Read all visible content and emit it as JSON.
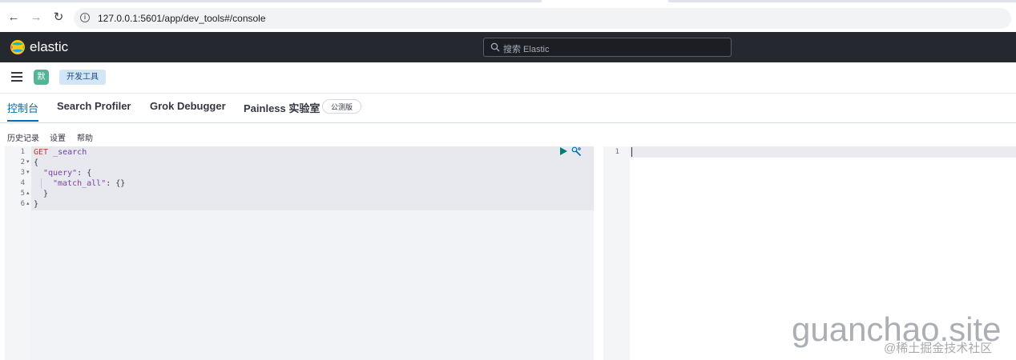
{
  "browser": {
    "back_icon": "arrow-left-icon",
    "forward_icon": "arrow-right-icon",
    "reload_icon": "reload-icon",
    "url": "127.0.0.1:5601/app/dev_tools#/console"
  },
  "header": {
    "logo_text": "elastic",
    "search_placeholder": "搜索 Elastic"
  },
  "breadcrumb": {
    "space_initial": "默",
    "current": "开发工具"
  },
  "tabs": [
    {
      "label": "控制台",
      "selected": true
    },
    {
      "label": "Search Profiler",
      "selected": false
    },
    {
      "label": "Grok Debugger",
      "selected": false
    },
    {
      "label": "Painless 实验室",
      "selected": false
    }
  ],
  "beta_badge": "公测版",
  "console_menu": [
    "历史记录",
    "设置",
    "帮助"
  ],
  "editor": {
    "lines": [
      {
        "num": "1",
        "fold": "",
        "method": "GET",
        "text": " _search"
      },
      {
        "num": "2",
        "fold": "▾",
        "text": "{"
      },
      {
        "num": "3",
        "fold": "▾",
        "key": "\"query\"",
        "text": ": {"
      },
      {
        "num": "4",
        "fold": "",
        "key": "\"match_all\"",
        "text": ": {}"
      },
      {
        "num": "5",
        "fold": "▴",
        "text": "}"
      },
      {
        "num": "6",
        "fold": "▴",
        "text": "}"
      }
    ]
  },
  "output": {
    "lines": [
      {
        "num": "1"
      }
    ]
  },
  "colors": {
    "header_bg": "#25282f",
    "accent": "#006bb8",
    "space_avatar": "#54b399",
    "play": "#017d73"
  },
  "watermark": {
    "main": "guanchao.site",
    "sub": "@稀土掘金技术社区"
  }
}
